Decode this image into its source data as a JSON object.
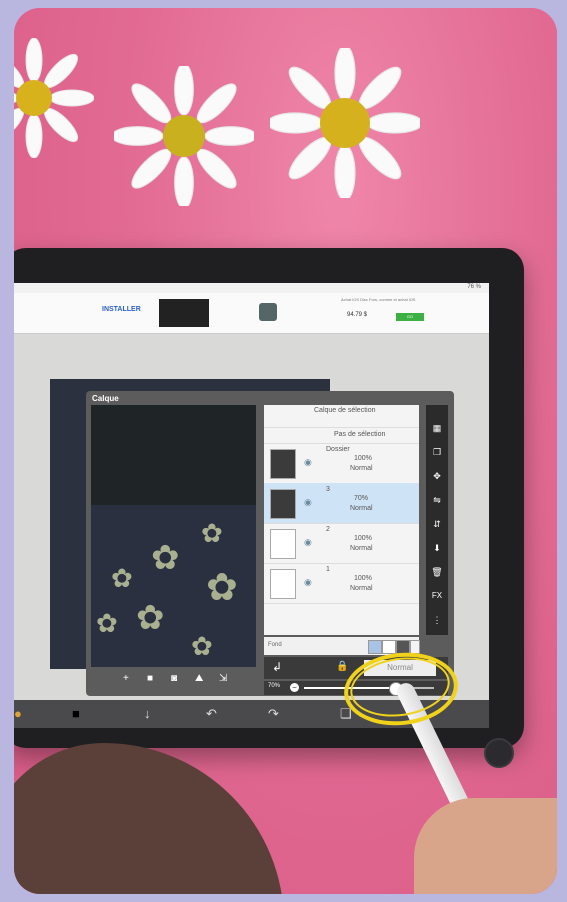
{
  "ad": {
    "install_label": "INSTALLER",
    "description": "Achat iOS Disc Fors, comme et achat iOS",
    "price": "94.79 $",
    "cta_label": "GO"
  },
  "status": {
    "battery": "76 %"
  },
  "panel": {
    "title": "Calque",
    "selection_layer_label": "Calque de sélection",
    "no_selection_label": "Pas de sélection",
    "layers": [
      {
        "name": "Dossier",
        "opacity": "100%",
        "mode": "Normal",
        "selected": false
      },
      {
        "name": "3",
        "opacity": "70%",
        "mode": "Normal",
        "selected": true
      },
      {
        "name": "2",
        "opacity": "100%",
        "mode": "Normal",
        "selected": false
      },
      {
        "name": "1",
        "opacity": "100%",
        "mode": "Normal",
        "selected": false
      }
    ],
    "background_label": "Fond",
    "blend_mode": "Normal",
    "opacity_label": "70%",
    "opacity_value": 0.7,
    "fx_label": "FX"
  },
  "colors": {
    "background_pink": "#e4638e",
    "highlight_circle": "#f0d21a",
    "selected_layer": "#cfe3f7"
  }
}
